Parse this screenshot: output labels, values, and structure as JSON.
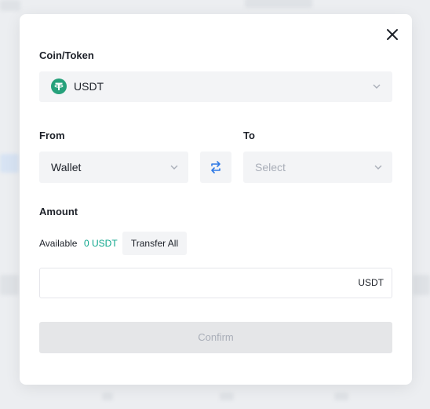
{
  "modal": {
    "coin_label": "Coin/Token",
    "coin_select": {
      "value": "USDT",
      "icon": "tether-icon",
      "icon_color": "#26a17b"
    },
    "from_label": "From",
    "from_select": {
      "value": "Wallet"
    },
    "to_label": "To",
    "to_select": {
      "placeholder": "Select"
    },
    "amount_label": "Amount",
    "available_label": "Available",
    "available_value": "0 USDT",
    "transfer_all_label": "Transfer All",
    "amount_input": {
      "value": "",
      "unit": "USDT"
    },
    "confirm_label": "Confirm"
  },
  "colors": {
    "accent_green": "#0ba58b",
    "swap_icon": "#2f7ae5",
    "disabled_text": "#a9aeb8"
  }
}
